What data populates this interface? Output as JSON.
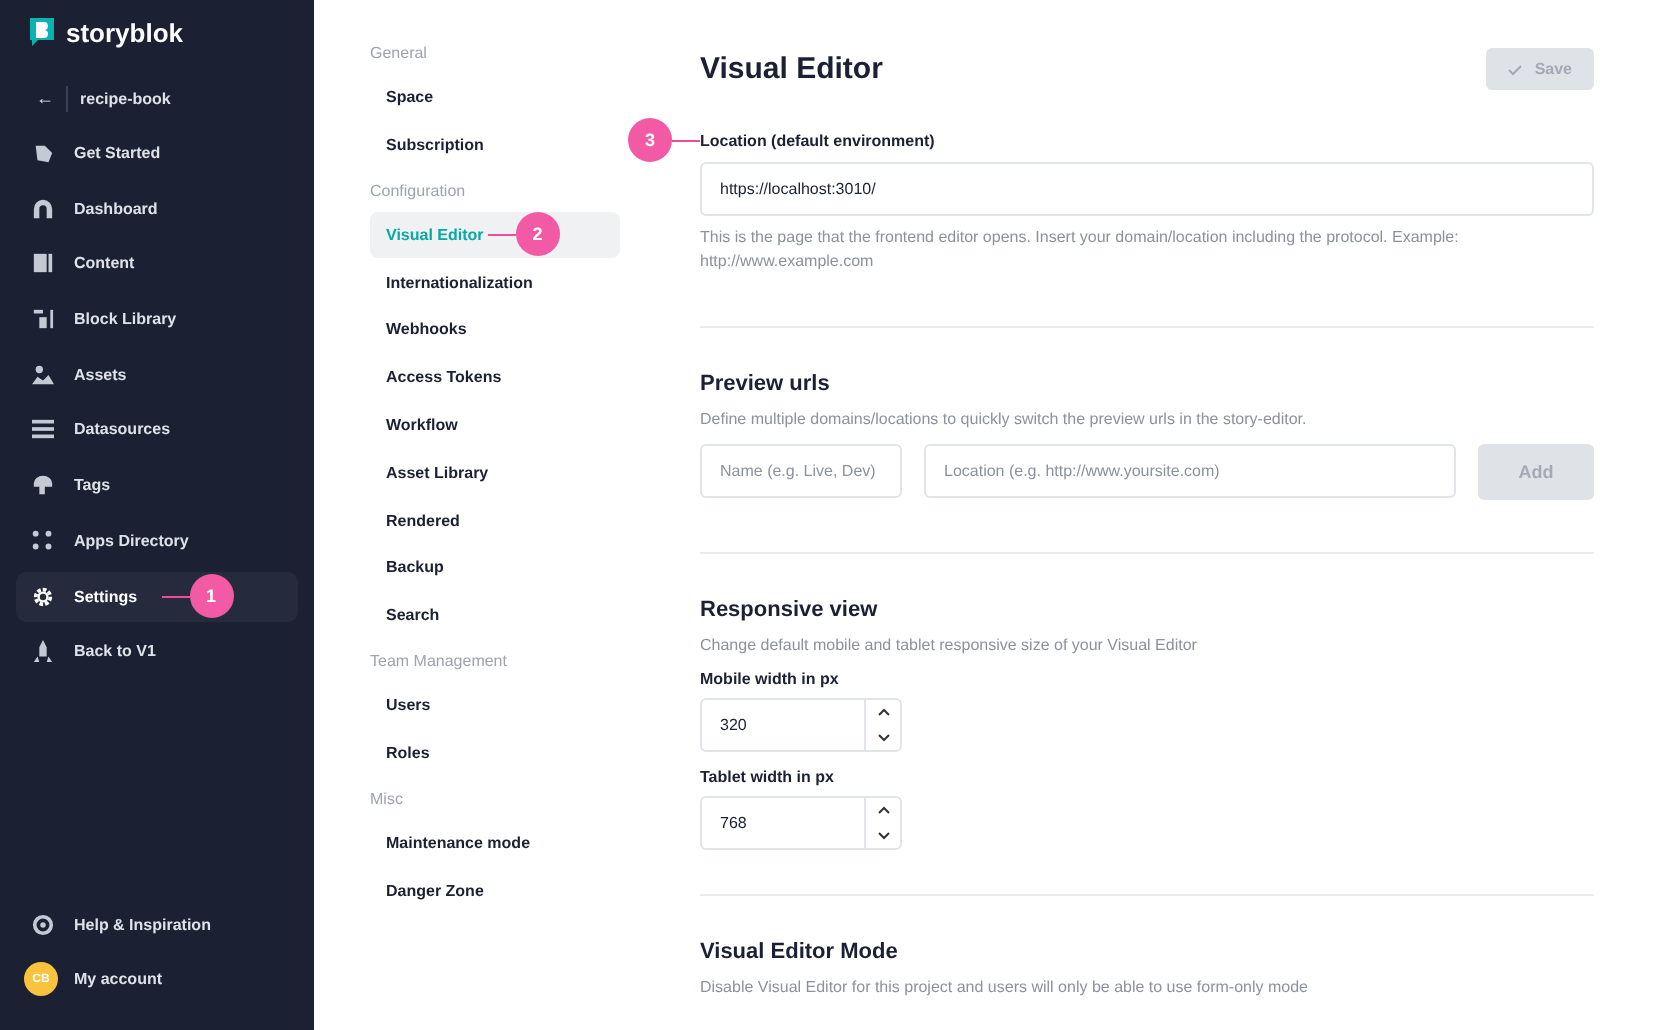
{
  "sidebar": {
    "logo": "storyblok",
    "back": {
      "icon": "←",
      "label": "recipe-book"
    },
    "items": [
      {
        "label": "Get Started",
        "kind": "start",
        "selected": false
      },
      {
        "label": "Dashboard",
        "kind": "dashboard",
        "selected": false
      },
      {
        "label": "Content",
        "kind": "content",
        "selected": false
      },
      {
        "label": "Block Library",
        "kind": "blocks",
        "selected": false
      },
      {
        "label": "Assets",
        "kind": "assets",
        "selected": false
      },
      {
        "label": "Datasources",
        "kind": "list",
        "selected": false
      },
      {
        "label": "Tags",
        "kind": "tag",
        "selected": false
      },
      {
        "label": "Apps Directory",
        "kind": "apps",
        "selected": false
      },
      {
        "label": "Settings",
        "kind": "gear",
        "selected": true,
        "callout": "1"
      },
      {
        "label": "Back to V1",
        "kind": "rocket",
        "selected": false
      }
    ],
    "footer": [
      {
        "label": "Help & Inspiration",
        "kind": "help"
      },
      {
        "label": "My account",
        "kind": "account",
        "initials": "CB"
      }
    ]
  },
  "settings_nav": [
    {
      "heading": "General",
      "items": [
        {
          "label": "Space",
          "selected": false
        },
        {
          "label": "Subscription",
          "selected": false
        }
      ]
    },
    {
      "heading": "Configuration",
      "items": [
        {
          "label": "Visual Editor",
          "selected": true,
          "callout": "2"
        },
        {
          "label": "Internationalization",
          "selected": false
        },
        {
          "label": "Webhooks",
          "selected": false
        },
        {
          "label": "Access Tokens",
          "selected": false
        },
        {
          "label": "Workflow",
          "selected": false
        },
        {
          "label": "Asset Library",
          "selected": false
        },
        {
          "label": "Rendered",
          "selected": false
        },
        {
          "label": "Backup",
          "selected": false
        },
        {
          "label": "Search",
          "selected": false
        }
      ]
    },
    {
      "heading": "Team Management",
      "items": [
        {
          "label": "Users",
          "selected": false
        },
        {
          "label": "Roles",
          "selected": false
        }
      ]
    },
    {
      "heading": "Misc",
      "items": [
        {
          "label": "Maintenance mode",
          "selected": false
        },
        {
          "label": "Danger Zone",
          "selected": false
        }
      ]
    }
  ],
  "main": {
    "title": "Visual Editor",
    "save_button": {
      "label": "Save",
      "disabled": true
    },
    "location": {
      "label": "Location (default environment)",
      "callout": "3",
      "value": "https://localhost:3010/",
      "help": "This is the page that the frontend editor opens. Insert your domain/location including the protocol. Example: http://www.example.com"
    },
    "preview_urls": {
      "title": "Preview urls",
      "description": "Define multiple domains/locations to quickly switch the preview urls in the story-editor.",
      "name_placeholder": "Name (e.g. Live, Dev)",
      "location_placeholder": "Location (e.g. http://www.yoursite.com)",
      "add_button": "Add"
    },
    "responsive_view": {
      "title": "Responsive view",
      "description": "Change default mobile and tablet responsive size of your Visual Editor",
      "fields": [
        {
          "label": "Mobile width in px",
          "value": "320"
        },
        {
          "label": "Tablet width in px",
          "value": "768"
        }
      ]
    },
    "editor_mode": {
      "title": "Visual Editor Mode",
      "description": "Disable Visual Editor for this project and users will only be able to use form-only mode"
    }
  }
}
